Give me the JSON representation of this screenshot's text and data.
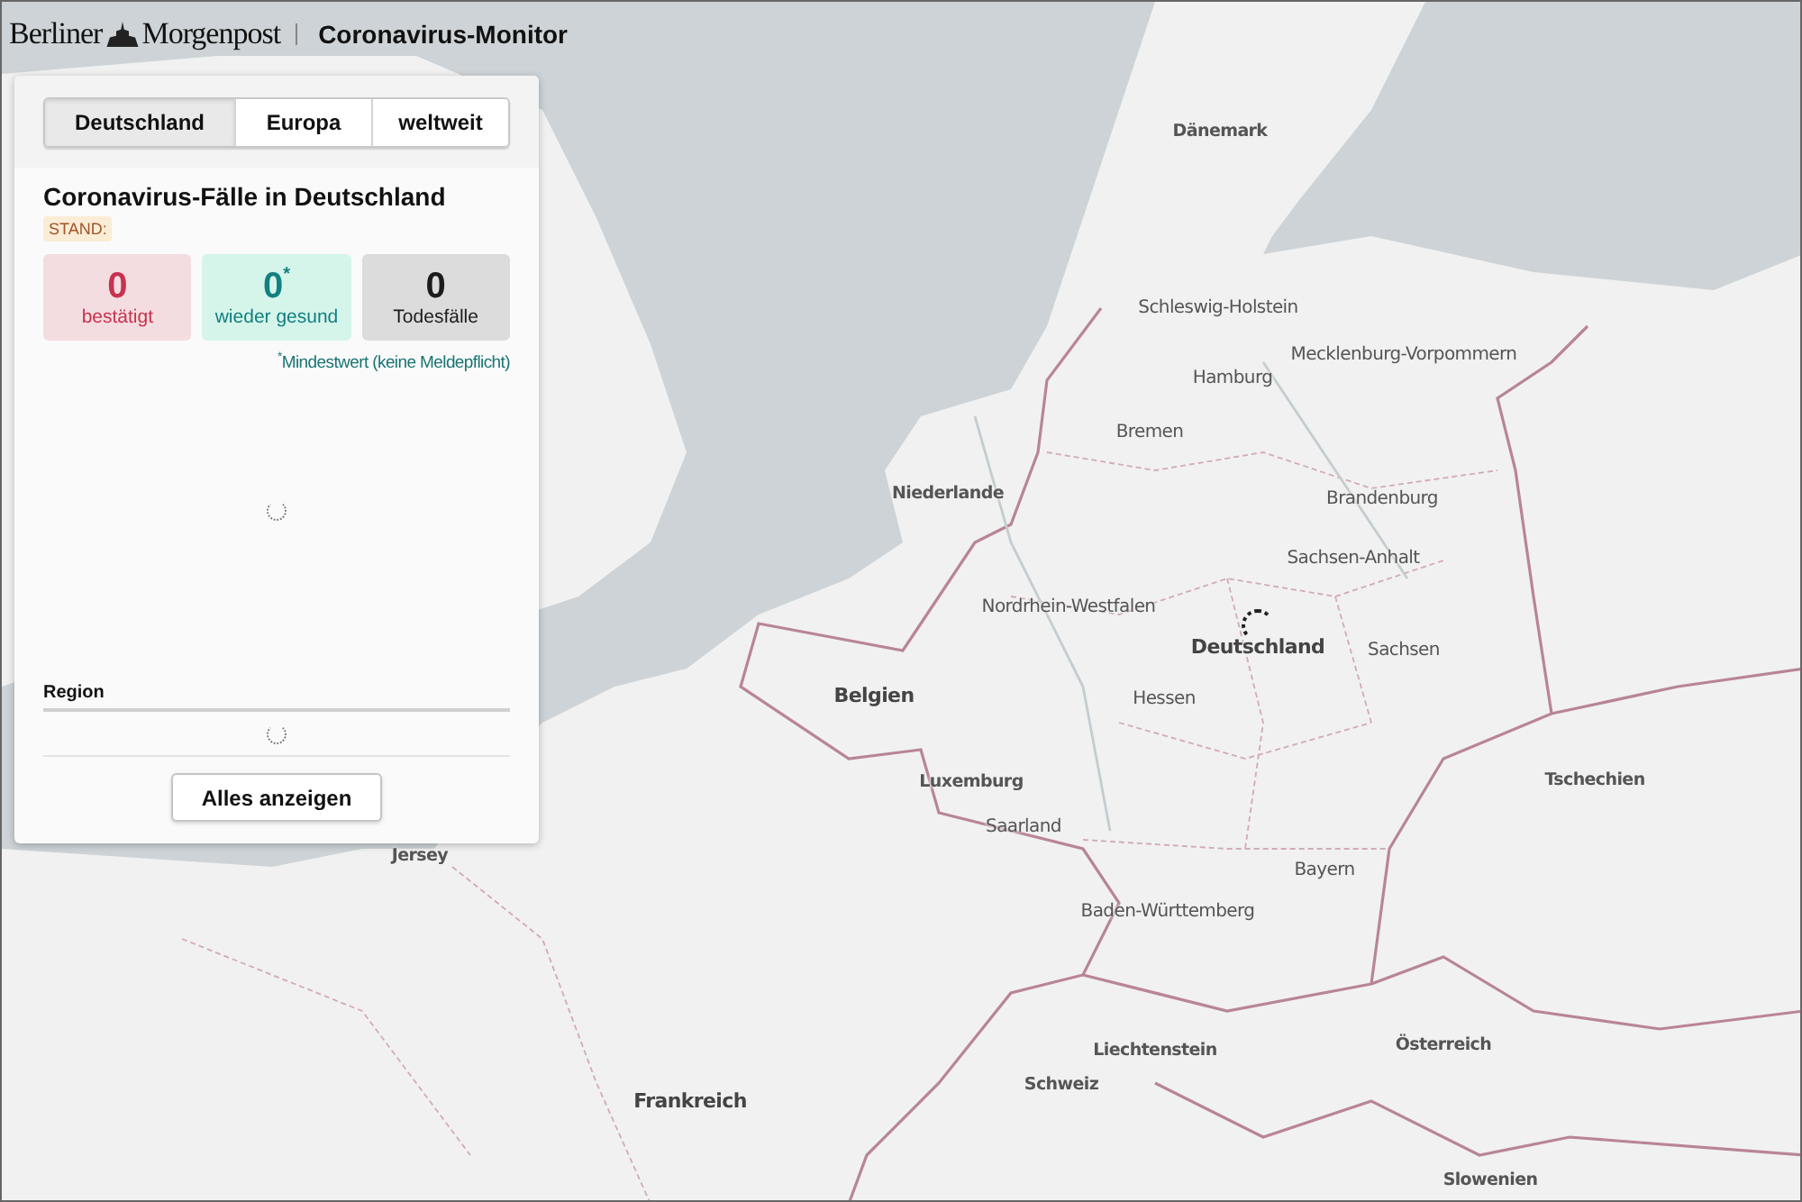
{
  "header": {
    "logo": "Berliner",
    "logo_2": "Morgenpost",
    "title": "Coronavirus-Monitor"
  },
  "panel": {
    "tabs": [
      {
        "label": "Deutschland",
        "selected": true
      },
      {
        "label": "Europa",
        "selected": false
      },
      {
        "label": "weltweit",
        "selected": false
      }
    ],
    "heading": "Coronavirus-Fälle in Deutschland",
    "stand": "STAND:",
    "stats": [
      {
        "kind": "confirmed",
        "value": "0",
        "label": "bestätigt"
      },
      {
        "kind": "recovered",
        "value": "0$^{*}$",
        "label": "wieder gesund"
      },
      {
        "kind": "deaths",
        "value": "0",
        "label": "Todesfälle"
      }
    ],
    "footnote": "$^{*}$Mindestwert (keine Meldepflicht)",
    "table_header": "Region",
    "button": "Alles anzeigen"
  },
  "map": {
    "labels": [
      {
        "kind": "country",
        "text": "Dänemark"
      },
      {
        "kind": "state",
        "text": "Schleswig-Holstein"
      },
      {
        "kind": "state",
        "text": "Mecklenburg-Vorpommern"
      },
      {
        "kind": "state",
        "text": "Hamburg"
      },
      {
        "kind": "state",
        "text": "Bremen"
      },
      {
        "kind": "country",
        "text": "Niederlande"
      },
      {
        "kind": "state",
        "text": "Brandenburg"
      },
      {
        "kind": "state",
        "text": "Sachsen-Anhalt"
      },
      {
        "kind": "state",
        "text": "Nordrhein-Westfalen"
      },
      {
        "kind": "capital",
        "text": "Deutschland"
      },
      {
        "kind": "state",
        "text": "Sachsen"
      },
      {
        "kind": "capital",
        "text": "Belgien"
      },
      {
        "kind": "state",
        "text": "Hessen"
      },
      {
        "kind": "country",
        "text": "Luxemburg"
      },
      {
        "kind": "country",
        "text": "Tschechien"
      },
      {
        "kind": "state",
        "text": "Saarland"
      },
      {
        "kind": "country",
        "text": "Jersey"
      },
      {
        "kind": "state",
        "text": "Bayern"
      },
      {
        "kind": "state",
        "text": "Baden-Württemberg"
      },
      {
        "kind": "country",
        "text": "Liechtenstein"
      },
      {
        "kind": "country",
        "text": "Österreich"
      },
      {
        "kind": "country",
        "text": "Schweiz"
      },
      {
        "kind": "capital",
        "text": "Frankreich"
      },
      {
        "kind": "country",
        "text": "Slowenien"
      }
    ]
  }
}
